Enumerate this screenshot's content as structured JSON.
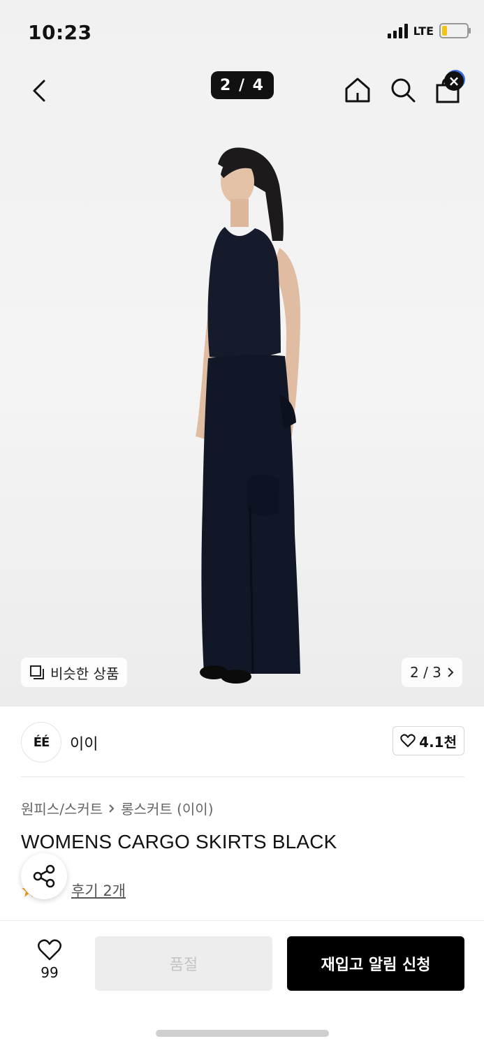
{
  "status_bar": {
    "time": "10:23",
    "network": "LTE"
  },
  "nav": {
    "page_indicator": "2 / 4"
  },
  "gallery": {
    "similar_label": "비슷한 상품",
    "color_pager": "2 / 3"
  },
  "brand": {
    "logo_text": "ÉÉ",
    "name": "이이",
    "likes": "4.1천"
  },
  "breadcrumb": {
    "category": "원피스/스커트",
    "subcategory": "롱스커트 (이이)"
  },
  "product": {
    "title": "WOMENS CARGO SKIRTS BLACK",
    "review_label": "후기 2개"
  },
  "bottom_bar": {
    "wish_count": "99",
    "soldout_label": "품절",
    "restock_label": "재입고 알림 신청"
  },
  "colors": {
    "accent_dark": "#000000",
    "badge_ring": "#3b6fe0",
    "rating_star": "#f0a020"
  }
}
